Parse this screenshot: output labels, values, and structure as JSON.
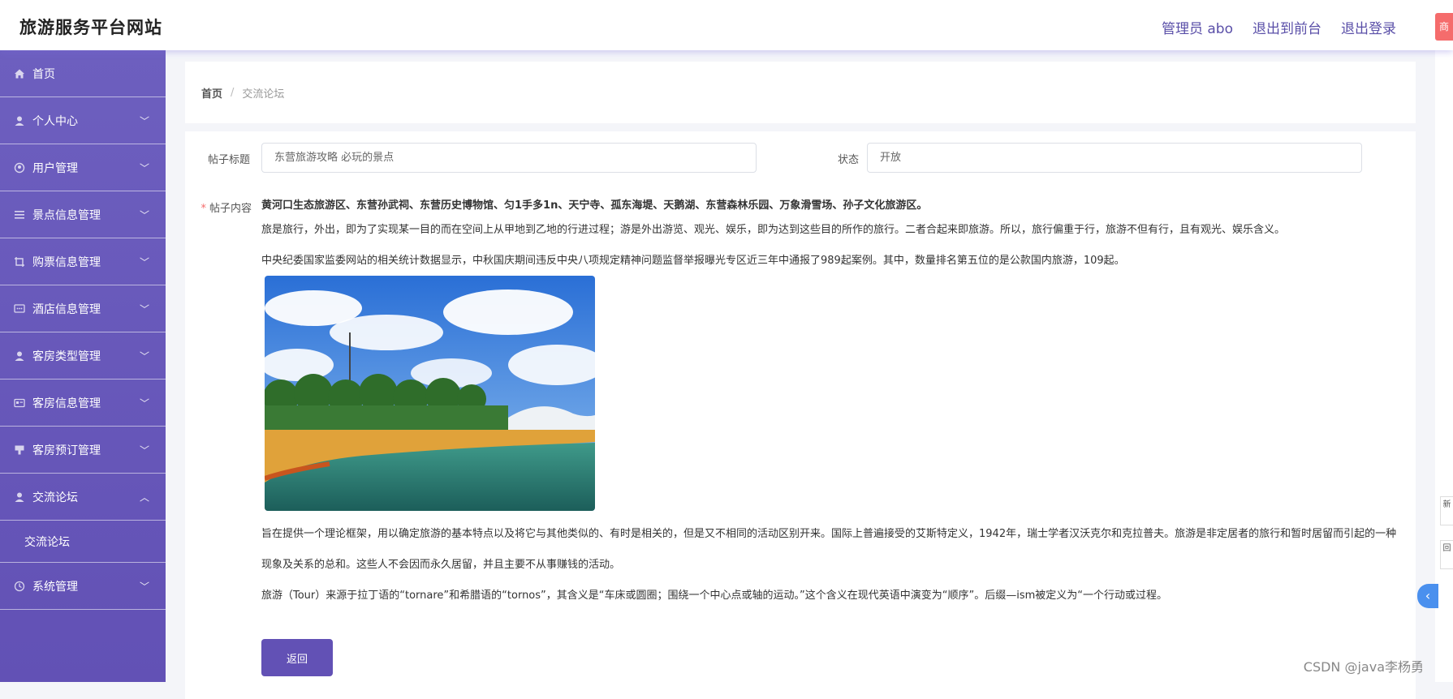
{
  "header": {
    "title": "旅游服务平台网站",
    "links": [
      "管理员 abo",
      "退出到前台",
      "退出登录"
    ],
    "corner_tag": "商"
  },
  "sidebar": {
    "items": [
      {
        "label": "首页",
        "icon": "home-icon",
        "expandable": false
      },
      {
        "label": "个人中心",
        "icon": "user-icon",
        "expandable": true
      },
      {
        "label": "用户管理",
        "icon": "users-icon",
        "expandable": true
      },
      {
        "label": "景点信息管理",
        "icon": "list-icon",
        "expandable": true
      },
      {
        "label": "购票信息管理",
        "icon": "crop-icon",
        "expandable": true
      },
      {
        "label": "酒店信息管理",
        "icon": "chat-icon",
        "expandable": true
      },
      {
        "label": "客房类型管理",
        "icon": "person-icon",
        "expandable": true
      },
      {
        "label": "客房信息管理",
        "icon": "card-icon",
        "expandable": true
      },
      {
        "label": "客房预订管理",
        "icon": "stamp-icon",
        "expandable": true
      },
      {
        "label": "交流论坛",
        "icon": "person-icon",
        "expandable": true,
        "expanded": true
      },
      {
        "label": "系统管理",
        "icon": "clock-icon",
        "expandable": true
      }
    ],
    "sub_item": "交流论坛"
  },
  "breadcrumb": {
    "home": "首页",
    "separator": "/",
    "current": "交流论坛"
  },
  "form": {
    "title_label": "帖子标题",
    "title_value": "东营旅游攻略 必玩的景点",
    "status_label": "状态",
    "status_value": "开放",
    "content_label": "帖子内容",
    "content": {
      "heading": "黄河口生态旅游区、东营孙武祠、东营历史博物馆、匀1手多1n、天宁寺、孤东海堤、天鹅湖、东营森林乐园、万象滑雪场、孙子文化旅游区。",
      "p1": "旅是旅行，外出，即为了实现某一目的而在空间上从甲地到乙地的行进过程；游是外出游览、观光、娱乐，即为达到这些目的所作的旅行。二者合起来即旅游。所以，旅行偏重于行，旅游不但有行，且有观光、娱乐含义。",
      "p2": "中央纪委国家监委网站的相关统计数据显示，中秋国庆期间违反中央八项规定精神问题监督举报曝光专区近三年中通报了989起案例。其中，数量排名第五位的是公款国内旅游，109起。",
      "p3": "旨在提供一个理论框架，用以确定旅游的基本特点以及将它与其他类似的、有时是相关的，但是又不相同的活动区别开来。国际上普遍接受的艾斯特定义，1942年，瑞士学者汉沃克尔和克拉普夫。旅游是非定居者的旅行和暂时居留而引起的一种现象及关系的总和。这些人不会因而永久居留，并且主要不从事赚钱的活动。",
      "p4": "旅游（Tour）来源于拉丁语的“tornare”和希腊语的“tornos”，其含义是“车床或圆圈；围绕一个中心点或轴的运动。”这个含义在现代英语中演变为“顺序”。后缀—ism被定义为“一个行动或过程。"
    },
    "back_button": "返回"
  },
  "edge": {
    "tab1": "新",
    "tab2": "回"
  },
  "watermark": "CSDN @java李杨勇",
  "colors": {
    "sidebar": "#6251b5",
    "accent": "#6251b5",
    "header_link": "#5a4fa8"
  }
}
